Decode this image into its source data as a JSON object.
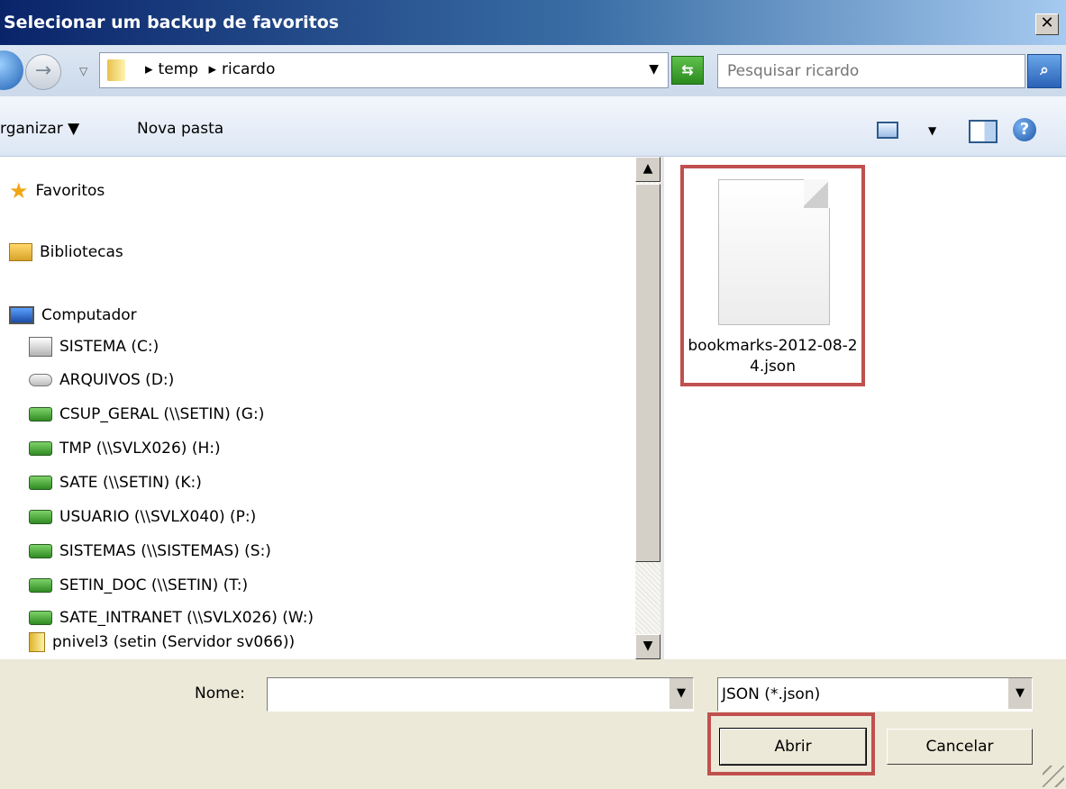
{
  "window": {
    "title": "Selecionar um backup de favoritos",
    "close_label": "✕"
  },
  "navbar": {
    "back_icon": "back-arrow-icon",
    "forward_icon": "forward-arrow-icon",
    "breadcrumbs": [
      "temp",
      "ricardo"
    ],
    "breadcrumb_separator": "▸",
    "search_placeholder": "Pesquisar ricardo"
  },
  "toolbar": {
    "organize_label": "rganizar ▼",
    "new_folder_label": "Nova pasta"
  },
  "nav_pane": {
    "favorites": "Favoritos",
    "libraries": "Bibliotecas",
    "computer": "Computador",
    "drives": [
      {
        "label": "SISTEMA (C:)",
        "icon": "system-drive-icon"
      },
      {
        "label": "ARQUIVOS (D:)",
        "icon": "hard-drive-icon"
      },
      {
        "label": "CSUP_GERAL (\\\\SETIN) (G:)",
        "icon": "network-drive-icon"
      },
      {
        "label": "TMP (\\\\SVLX026) (H:)",
        "icon": "network-drive-icon"
      },
      {
        "label": "SATE (\\\\SETIN) (K:)",
        "icon": "network-drive-icon"
      },
      {
        "label": "USUARIO (\\\\SVLX040) (P:)",
        "icon": "network-drive-icon"
      },
      {
        "label": "SISTEMAS (\\\\SISTEMAS) (S:)",
        "icon": "network-drive-icon"
      },
      {
        "label": "SETIN_DOC (\\\\SETIN) (T:)",
        "icon": "network-drive-icon"
      },
      {
        "label": "SATE_INTRANET (\\\\SVLX026) (W:)",
        "icon": "network-drive-icon"
      },
      {
        "label": "pnivel3 (setin (Servidor sv066))",
        "icon": "zip-folder-icon"
      }
    ]
  },
  "file_pane": {
    "files": [
      {
        "name": "bookmarks-2012-08-24.json",
        "icon": "blank-file-icon",
        "selected_highlight": true
      }
    ]
  },
  "footer": {
    "name_label": "Nome:",
    "name_value": "",
    "file_type": "JSON (*.json)",
    "open_label": "Abrir",
    "cancel_label": "Cancelar"
  },
  "colors": {
    "highlight": "#c0504d",
    "title_gradient_start": "#0a246a",
    "title_gradient_end": "#a6caf0"
  }
}
